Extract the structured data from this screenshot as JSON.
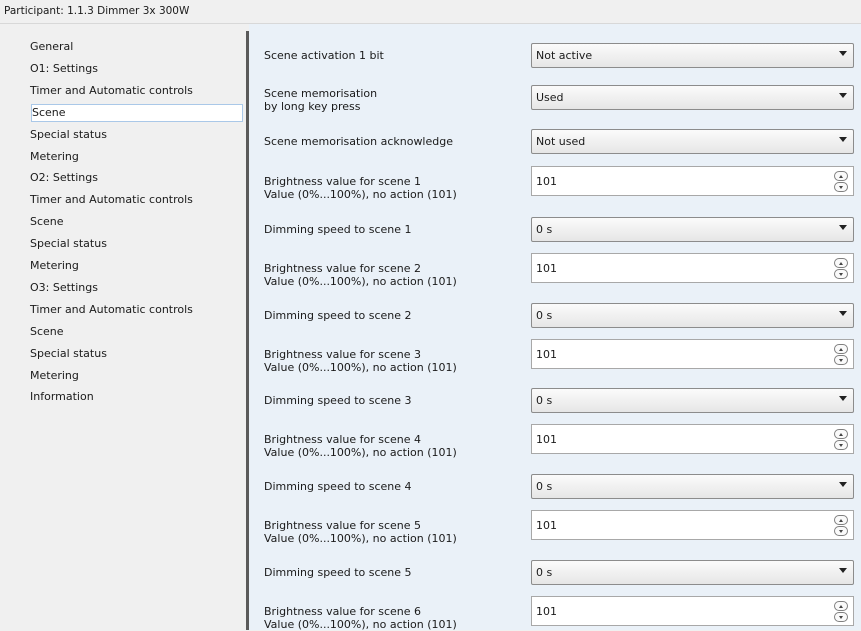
{
  "header": {
    "title": "Participant: 1.1.3  Dimmer 3x 300W"
  },
  "sidebar": {
    "items": [
      {
        "label": "General"
      },
      {
        "label": "O1: Settings"
      },
      {
        "label": "Timer and Automatic controls"
      },
      {
        "label": "Scene",
        "selected": true
      },
      {
        "label": "Special status"
      },
      {
        "label": "Metering"
      },
      {
        "label": "O2: Settings"
      },
      {
        "label": "Timer and Automatic controls"
      },
      {
        "label": "Scene"
      },
      {
        "label": "Special status"
      },
      {
        "label": "Metering"
      },
      {
        "label": "O3: Settings"
      },
      {
        "label": "Timer and Automatic controls"
      },
      {
        "label": "Scene"
      },
      {
        "label": "Special status"
      },
      {
        "label": "Metering"
      },
      {
        "label": "Information"
      }
    ]
  },
  "params": [
    {
      "label": "Scene activation 1 bit",
      "sublabel": "",
      "control": "select",
      "value": "Not active"
    },
    {
      "label": "Scene memorisation",
      "sublabel": "by long key press",
      "control": "select",
      "value": "Used"
    },
    {
      "label": "Scene memorisation acknowledge",
      "sublabel": "",
      "control": "select",
      "value": "Not used"
    },
    {
      "label": "Brightness value for scene 1",
      "sublabel": "Value (0%...100%), no action (101)",
      "control": "spin",
      "value": "101"
    },
    {
      "label": "Dimming speed to scene 1",
      "sublabel": "",
      "control": "select",
      "value": "0 s"
    },
    {
      "label": "Brightness value for scene 2",
      "sublabel": "Value (0%...100%), no action (101)",
      "control": "spin",
      "value": "101"
    },
    {
      "label": "Dimming speed to scene 2",
      "sublabel": "",
      "control": "select",
      "value": "0 s"
    },
    {
      "label": "Brightness value for scene 3",
      "sublabel": "Value (0%...100%), no action (101)",
      "control": "spin",
      "value": "101"
    },
    {
      "label": "Dimming speed to scene 3",
      "sublabel": "",
      "control": "select",
      "value": "0 s"
    },
    {
      "label": "Brightness value for scene 4",
      "sublabel": "Value (0%...100%), no action (101)",
      "control": "spin",
      "value": "101"
    },
    {
      "label": "Dimming speed to scene 4",
      "sublabel": "",
      "control": "select",
      "value": "0 s"
    },
    {
      "label": "Brightness value for scene 5",
      "sublabel": "Value (0%...100%), no action (101)",
      "control": "spin",
      "value": "101"
    },
    {
      "label": "Dimming speed to scene 5",
      "sublabel": "",
      "control": "select",
      "value": "0 s"
    },
    {
      "label": "Brightness value for scene 6",
      "sublabel": "Value (0%...100%), no action (101)",
      "control": "spin",
      "value": "101"
    }
  ]
}
